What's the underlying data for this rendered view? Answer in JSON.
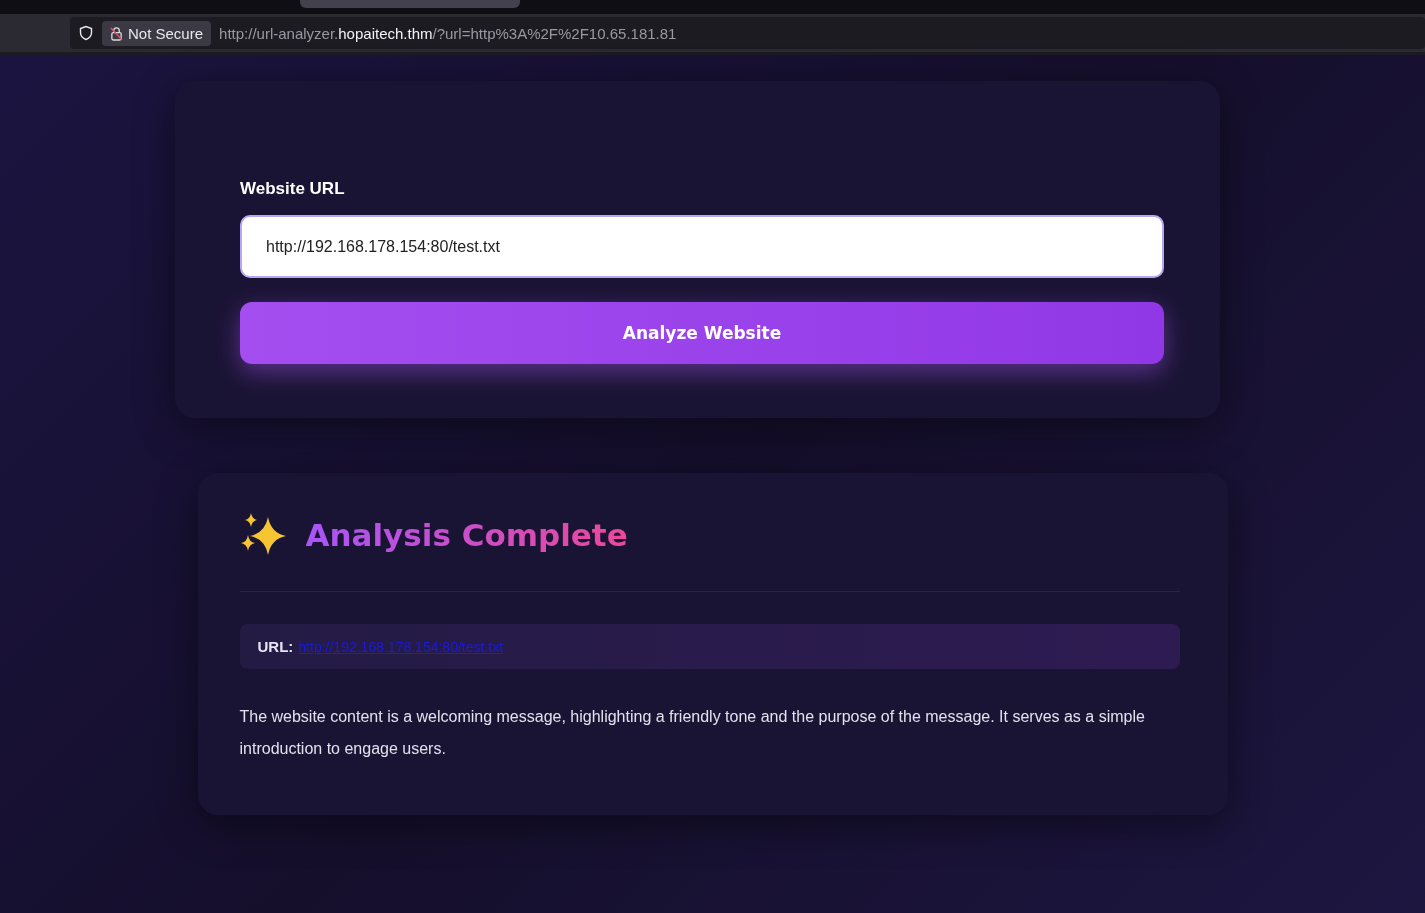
{
  "browser": {
    "security_label": "Not Secure",
    "url_prefix": "http://url-analyzer.",
    "url_domain": "hopaitech.thm",
    "url_suffix": "/?url=http%3A%2F%2F10.65.181.81"
  },
  "form": {
    "label": "Website URL",
    "value": "http://192.168.178.154:80/test.txt",
    "button": "Analyze Website"
  },
  "result": {
    "title": "Analysis Complete",
    "url_label": "URL:",
    "url_link": "http://192.168.178.154:80/test.txt",
    "summary": "The website content is a welcoming message, highlighting a friendly tone and the purpose of the message. It serves as a simple introduction to engage users."
  }
}
